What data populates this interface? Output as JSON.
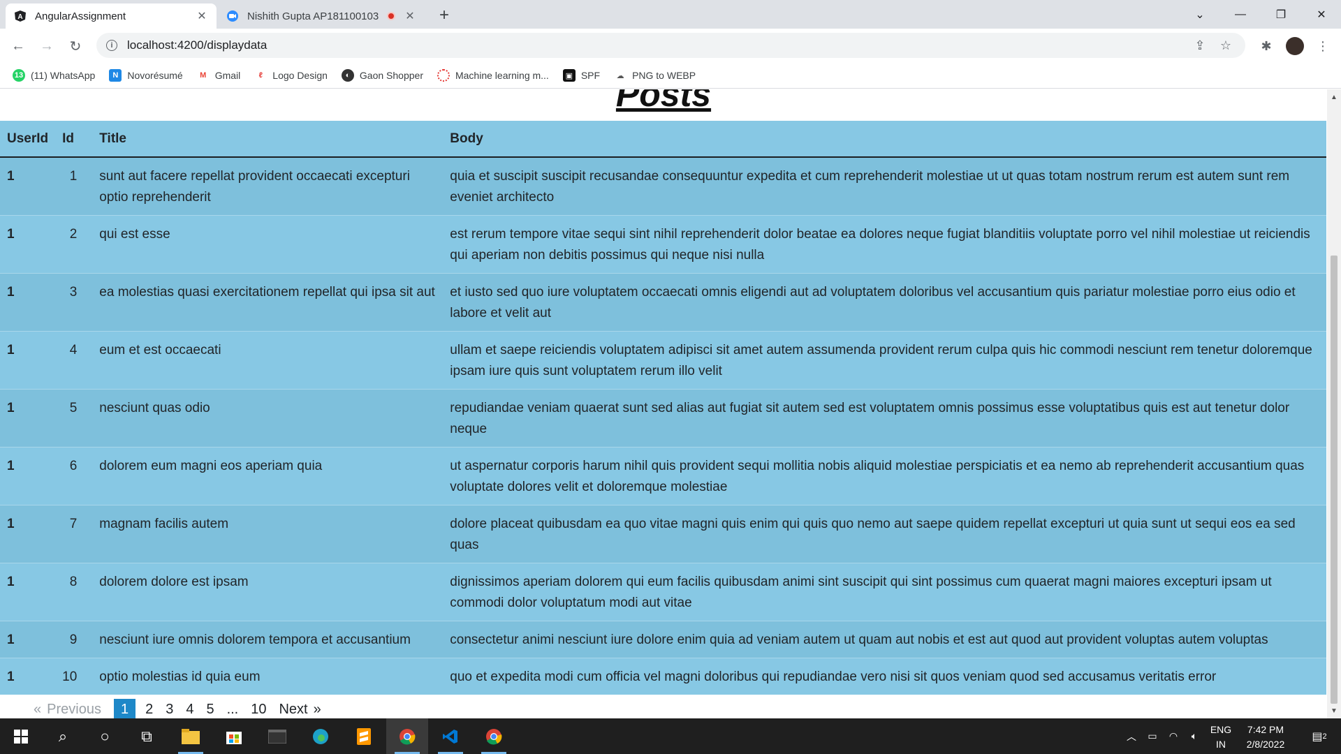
{
  "browser": {
    "tabs": [
      {
        "label": "AngularAssignment",
        "active": true
      },
      {
        "label": "Nishith Gupta AP181100103",
        "active": false
      }
    ],
    "url": "localhost:4200/displaydata",
    "bookmarks": [
      {
        "label": "(11) WhatsApp",
        "icon": "whatsapp-icon",
        "color": "#25d366"
      },
      {
        "label": "Novorésumé",
        "icon": "novoresume-icon",
        "color": "#1e88e5"
      },
      {
        "label": "Gmail",
        "icon": "gmail-icon",
        "color": "#ea4335"
      },
      {
        "label": "Logo Design",
        "icon": "logo-design-icon",
        "color": "#e53935"
      },
      {
        "label": "Gaon Shopper",
        "icon": "gaon-shopper-icon",
        "color": "#333333"
      },
      {
        "label": "Machine learning m...",
        "icon": "machine-learning-icon",
        "color": "#e53935"
      },
      {
        "label": "SPF",
        "icon": "spf-icon",
        "color": "#111111"
      },
      {
        "label": "PNG to WEBP",
        "icon": "png-webp-icon",
        "color": "#555555"
      }
    ]
  },
  "page": {
    "heading": "Posts",
    "columns": [
      "UserId",
      "Id",
      "Title",
      "Body"
    ],
    "rows": [
      {
        "userId": "1",
        "id": "1",
        "title": "sunt aut facere repellat provident occaecati excepturi optio reprehenderit",
        "body": "quia et suscipit suscipit recusandae consequuntur expedita et cum reprehenderit molestiae ut ut quas totam nostrum rerum est autem sunt rem eveniet architecto"
      },
      {
        "userId": "1",
        "id": "2",
        "title": "qui est esse",
        "body": "est rerum tempore vitae sequi sint nihil reprehenderit dolor beatae ea dolores neque fugiat blanditiis voluptate porro vel nihil molestiae ut reiciendis qui aperiam non debitis possimus qui neque nisi nulla"
      },
      {
        "userId": "1",
        "id": "3",
        "title": "ea molestias quasi exercitationem repellat qui ipsa sit aut",
        "body": "et iusto sed quo iure voluptatem occaecati omnis eligendi aut ad voluptatem doloribus vel accusantium quis pariatur molestiae porro eius odio et labore et velit aut"
      },
      {
        "userId": "1",
        "id": "4",
        "title": "eum et est occaecati",
        "body": "ullam et saepe reiciendis voluptatem adipisci sit amet autem assumenda provident rerum culpa quis hic commodi nesciunt rem tenetur doloremque ipsam iure quis sunt voluptatem rerum illo velit"
      },
      {
        "userId": "1",
        "id": "5",
        "title": "nesciunt quas odio",
        "body": "repudiandae veniam quaerat sunt sed alias aut fugiat sit autem sed est voluptatem omnis possimus esse voluptatibus quis est aut tenetur dolor neque"
      },
      {
        "userId": "1",
        "id": "6",
        "title": "dolorem eum magni eos aperiam quia",
        "body": "ut aspernatur corporis harum nihil quis provident sequi mollitia nobis aliquid molestiae perspiciatis et ea nemo ab reprehenderit accusantium quas voluptate dolores velit et doloremque molestiae"
      },
      {
        "userId": "1",
        "id": "7",
        "title": "magnam facilis autem",
        "body": "dolore placeat quibusdam ea quo vitae magni quis enim qui quis quo nemo aut saepe quidem repellat excepturi ut quia sunt ut sequi eos ea sed quas"
      },
      {
        "userId": "1",
        "id": "8",
        "title": "dolorem dolore est ipsam",
        "body": "dignissimos aperiam dolorem qui eum facilis quibusdam animi sint suscipit qui sint possimus cum quaerat magni maiores excepturi ipsam ut commodi dolor voluptatum modi aut vitae"
      },
      {
        "userId": "1",
        "id": "9",
        "title": "nesciunt iure omnis dolorem tempora et accusantium",
        "body": "consectetur animi nesciunt iure dolore enim quia ad veniam autem ut quam aut nobis et est aut quod aut provident voluptas autem voluptas"
      },
      {
        "userId": "1",
        "id": "10",
        "title": "optio molestias id quia eum",
        "body": "quo et expedita modi cum officia vel magni doloribus qui repudiandae vero nisi sit quos veniam quod sed accusamus veritatis error"
      }
    ],
    "pagination": {
      "previous": "Previous",
      "next": "Next",
      "prev_glyph": "«",
      "next_glyph": "»",
      "pages": [
        "1",
        "2",
        "3",
        "4",
        "5",
        "...",
        "10"
      ],
      "current": "1"
    }
  },
  "taskbar": {
    "lang_top": "ENG",
    "lang_bottom": "IN",
    "time": "7:42 PM",
    "date": "2/8/2022",
    "notifications": "2"
  },
  "colors": {
    "table_row_light": "#87c8e4",
    "table_row_dark": "#7ec0dc",
    "pager_active": "#1e88c8"
  }
}
